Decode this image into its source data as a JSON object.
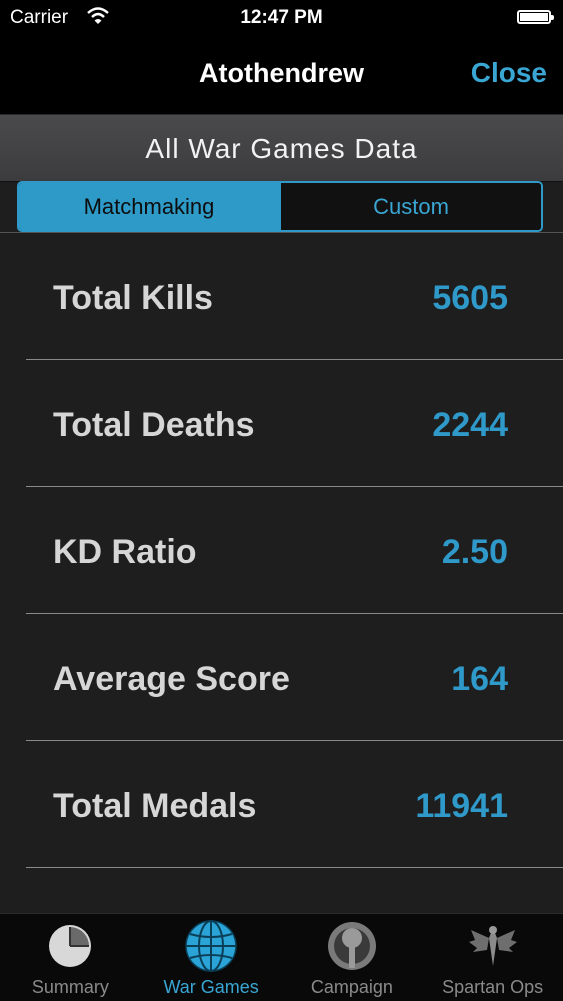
{
  "status_bar": {
    "carrier": "Carrier",
    "time": "12:47 PM"
  },
  "nav": {
    "title": "Atothendrew",
    "close_label": "Close"
  },
  "section": {
    "title": "All War Games Data"
  },
  "segmented": {
    "options": [
      "Matchmaking",
      "Custom"
    ],
    "selected": "Matchmaking"
  },
  "stats": [
    {
      "label": "Total Kills",
      "value": "5605"
    },
    {
      "label": "Total Deaths",
      "value": "2244"
    },
    {
      "label": "KD Ratio",
      "value": "2.50"
    },
    {
      "label": "Average Score",
      "value": "164"
    },
    {
      "label": "Total Medals",
      "value": "11941"
    }
  ],
  "tabs": [
    {
      "label": "Summary",
      "icon": "pie-chart-icon",
      "active": false
    },
    {
      "label": "War Games",
      "icon": "globe-icon",
      "active": true
    },
    {
      "label": "Campaign",
      "icon": "campaign-emblem-icon",
      "active": false
    },
    {
      "label": "Spartan Ops",
      "icon": "eagle-emblem-icon",
      "active": false
    }
  ],
  "colors": {
    "accent": "#2f9ac9",
    "background": "#1e1e1f",
    "navbar": "#000000"
  }
}
